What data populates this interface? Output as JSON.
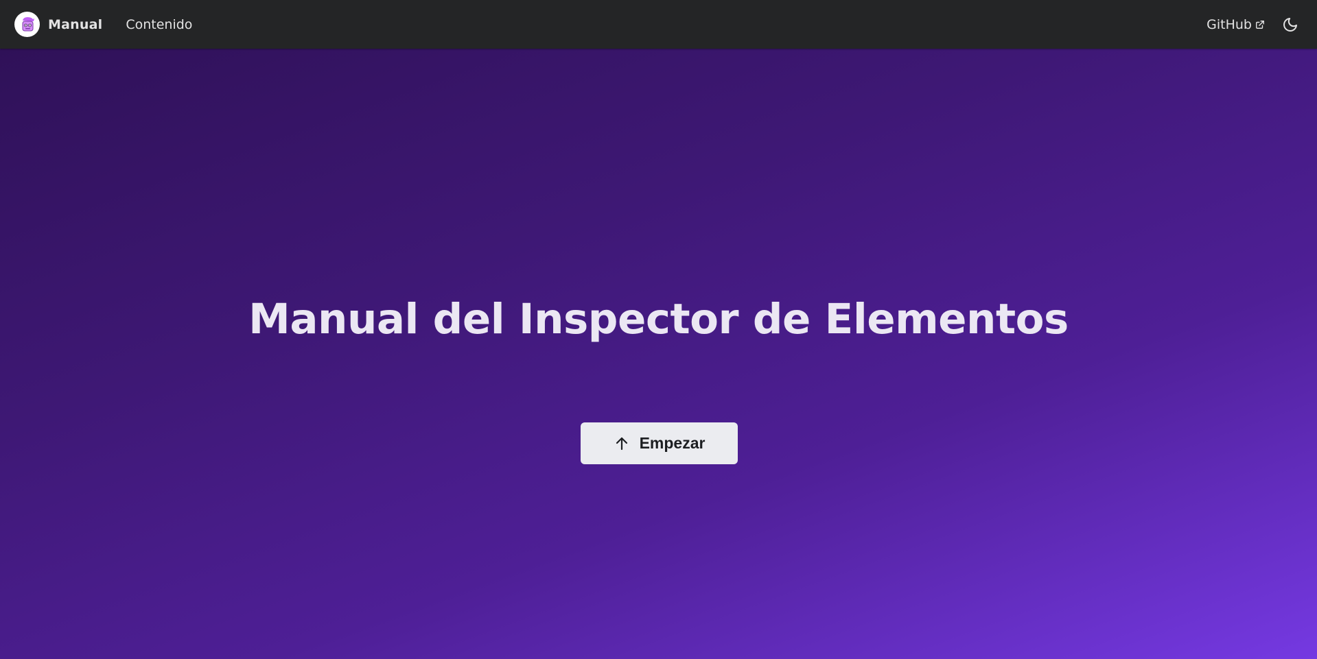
{
  "navbar": {
    "brand_title": "Manual",
    "logo_icon": "robot-logo-icon",
    "links": [
      {
        "label": "Contenido"
      }
    ],
    "github_label": "GitHub",
    "external_icon": "external-link-icon",
    "theme_icon": "moon-icon"
  },
  "hero": {
    "title": "Manual del Inspector de Elementos",
    "button_label": "Empezar",
    "button_icon": "arrow-up-icon"
  },
  "colors": {
    "navbar_bg": "#242526",
    "hero_gradient_start": "#2f1158",
    "hero_gradient_end": "#7539e2",
    "button_bg": "#ebecf0",
    "logo_accent": "#c061f5"
  }
}
